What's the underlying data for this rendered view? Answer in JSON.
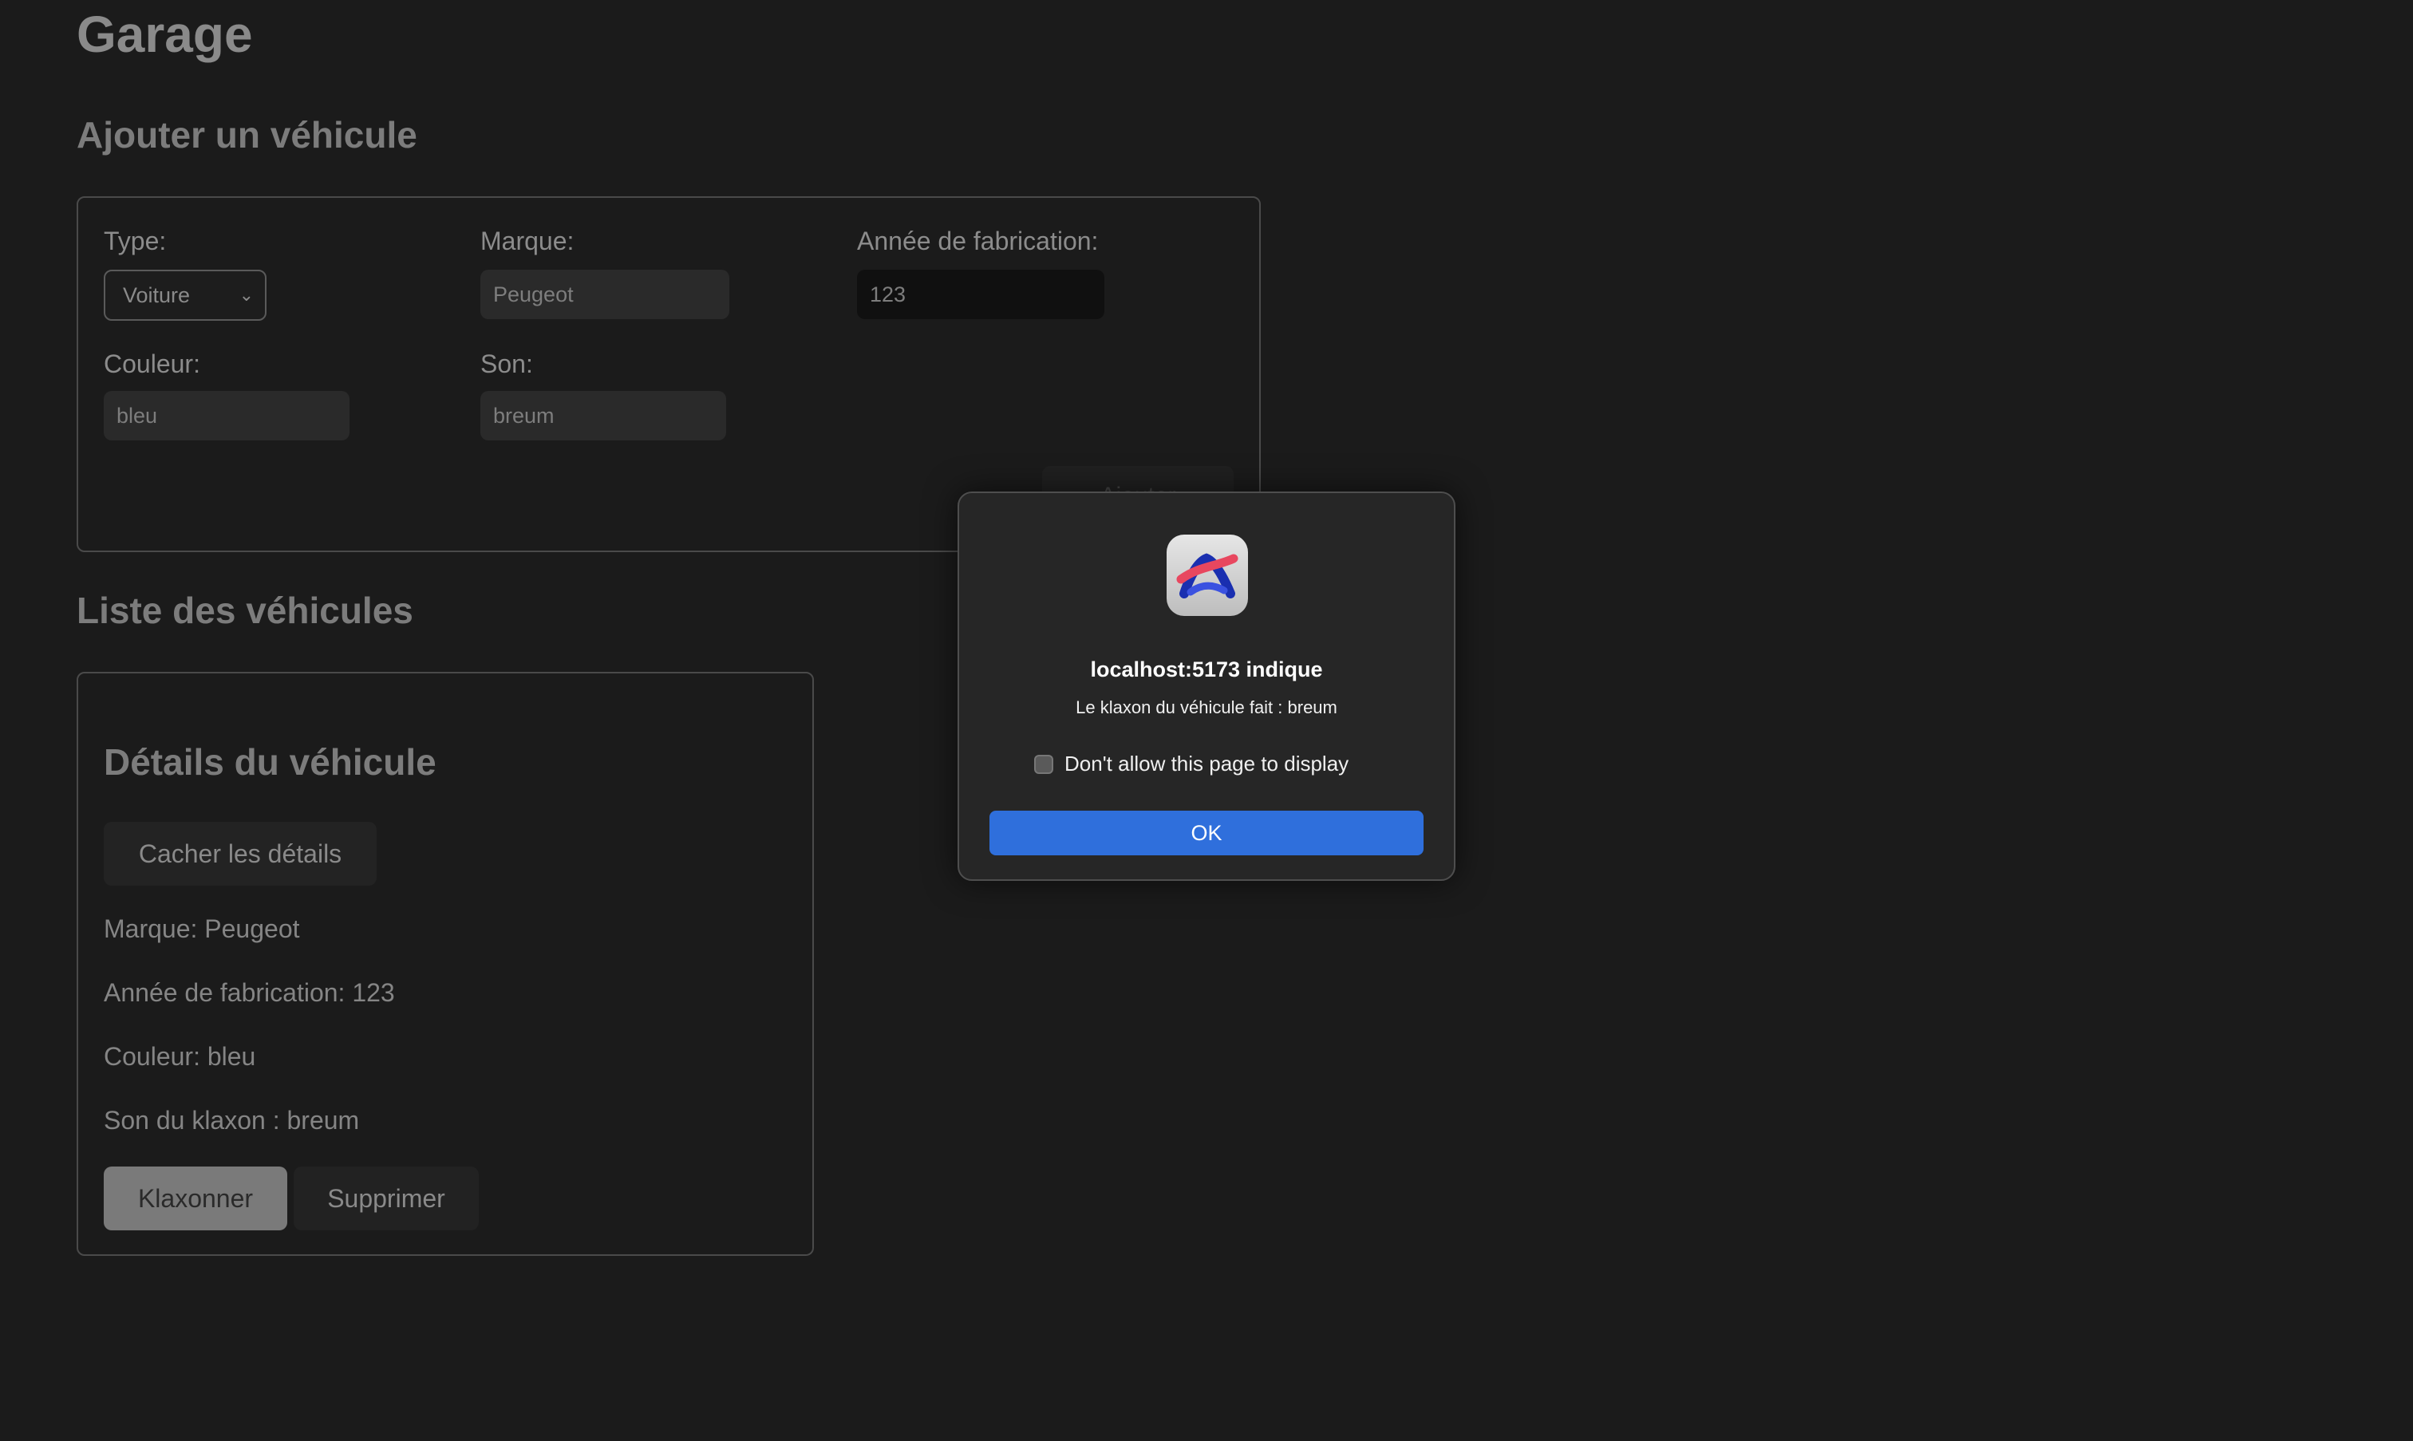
{
  "page": {
    "title": "Garage"
  },
  "add_vehicle": {
    "title": "Ajouter un véhicule",
    "type_label": "Type:",
    "type_value": "Voiture",
    "brand_label": "Marque:",
    "brand_value": "Peugeot",
    "year_label": "Année de fabrication:",
    "year_value": "123",
    "color_label": "Couleur:",
    "color_value": "bleu",
    "sound_label": "Son:",
    "sound_value": "breum",
    "submit_label": "Ajouter"
  },
  "vehicle_list": {
    "title": "Liste des véhicules",
    "details": {
      "heading": "Détails du véhicule",
      "hide_button": "Cacher les détails",
      "brand_line": "Marque: Peugeot",
      "year_line": "Année de fabrication: 123",
      "color_line": "Couleur: bleu",
      "sound_line": "Son du klaxon : breum",
      "honk_button": "Klaxonner",
      "delete_button": "Supprimer"
    }
  },
  "dialog": {
    "title": "localhost:5173 indique",
    "message": "Le klaxon du véhicule fait : breum",
    "checkbox_label": "Don't allow this page to display",
    "ok_label": "OK",
    "icon": "arc-browser-icon"
  },
  "colors": {
    "background": "#1b1b1b",
    "ok_button": "#2f6fdc"
  }
}
